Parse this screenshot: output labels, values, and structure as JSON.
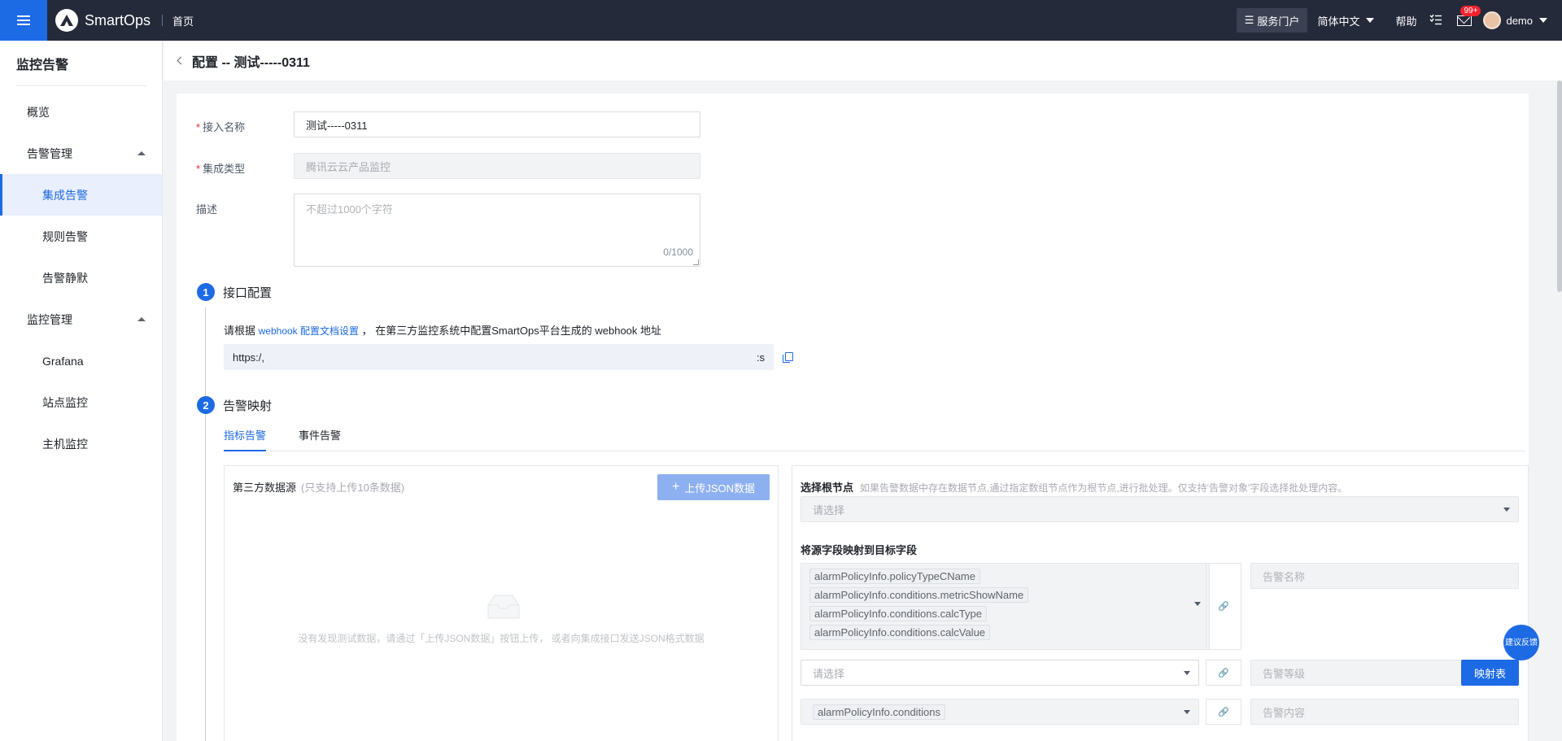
{
  "topbar": {
    "brand": "SmartOps",
    "home": "首页",
    "portal": "服务门户",
    "language": "简体中文",
    "help": "帮助",
    "mail_badge": "99+",
    "user": "demo"
  },
  "sidebar": {
    "title": "监控告警",
    "items": [
      {
        "label": "概览"
      },
      {
        "label": "告警管理"
      },
      {
        "label": "集成告警"
      },
      {
        "label": "规则告警"
      },
      {
        "label": "告警静默"
      },
      {
        "label": "监控管理"
      },
      {
        "label": "Grafana"
      },
      {
        "label": "站点监控"
      },
      {
        "label": "主机监控"
      }
    ]
  },
  "page": {
    "title": "配置 -- 测试-----0311"
  },
  "form": {
    "name_label": "接入名称",
    "name_value": "测试-----0311",
    "type_label": "集成类型",
    "type_value": "腾讯云云产品监控",
    "desc_label": "描述",
    "desc_placeholder": "不超过1000个字符",
    "desc_counter": "0/1000"
  },
  "step1": {
    "num": "1",
    "title": "接口配置",
    "hint_prefix": "请根据",
    "hint_link": "webhook 配置文档设置",
    "hint_suffix": "， 在第三方监控系统中配置SmartOps平台生成的 webhook 地址",
    "url_start": "https:/,",
    "url_end": ":s"
  },
  "step2": {
    "num": "2",
    "title": "告警映射",
    "tabs": [
      "指标告警",
      "事件告警"
    ],
    "left": {
      "title": "第三方数据源",
      "subtitle": "(只支持上传10条数据)",
      "upload": "上传JSON数据",
      "empty": "没有发现测试数据，请通过「上传JSON数据」按钮上传， 或者向集成接口发送JSON格式数据"
    },
    "right": {
      "root_label": "选择根节点",
      "root_hint": "如果告警数据中存在数据节点,通过指定数组节点作为根节点,进行批处理。仅支持'告警对象'字段选择批处理内容。",
      "root_placeholder": "请选择",
      "map_label": "将源字段映射到目标字段",
      "multi_tags": [
        "alarmPolicyInfo.policyTypeCName",
        "alarmPolicyInfo.conditions.metricShowName",
        "alarmPolicyInfo.conditions.calcType",
        "alarmPolicyInfo.conditions.calcValue"
      ],
      "target1": "告警名称",
      "select2": "请选择",
      "target2": "告警等级",
      "map_btn": "映射表",
      "select3": "alarmPolicyInfo.conditions",
      "target3": "告警内容"
    }
  },
  "feedback": "建议反馈"
}
